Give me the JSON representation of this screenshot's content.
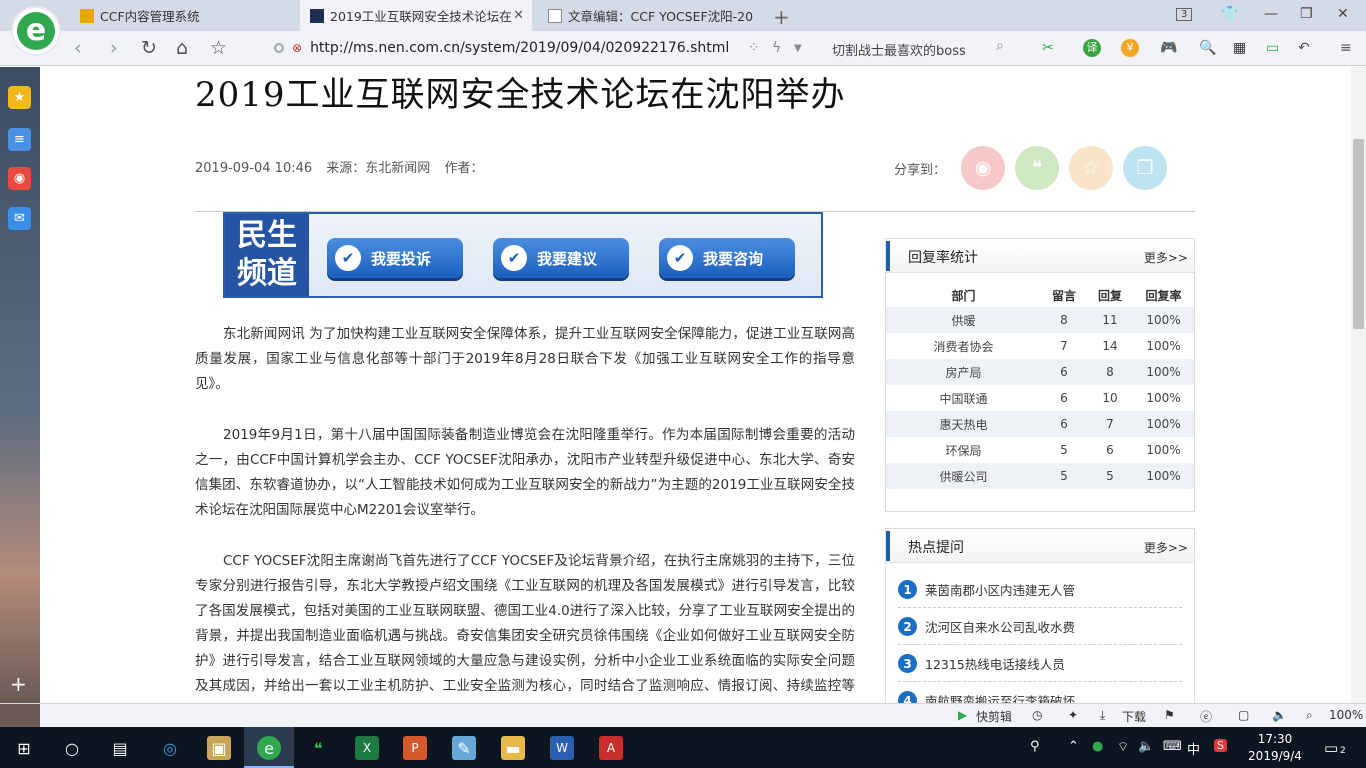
{
  "browser": {
    "tabs": [
      {
        "title": "CCF内容管理系统",
        "active": false
      },
      {
        "title": "2019工业互联网安全技术论坛在",
        "active": true
      },
      {
        "title": "文章编辑：CCF YOCSEF沈阳-20",
        "active": false
      }
    ],
    "tab_count": "3",
    "url": "http://ms.nen.com.cn/system/2019/09/04/020922176.shtml",
    "search_hint": "切割战士最喜欢的boss",
    "logo_letter": "e",
    "accent": "#2fa84f"
  },
  "article": {
    "title": "2019工业互联网安全技术论坛在沈阳举办",
    "date": "2019-09-04 10:46",
    "source": "来源：东北新闻网",
    "author": "作者：",
    "share_label": "分享到：",
    "share_icons": [
      "weibo-icon",
      "wechat-icon",
      "favorite-icon",
      "copy-icon"
    ],
    "banner": {
      "badge_line1": "民生",
      "badge_line2": "频道",
      "buttons": [
        "我要投诉",
        "我要建议",
        "我要咨询"
      ]
    },
    "paragraphs": [
      "东北新闻网讯 为了加快构建工业互联网安全保障体系，提升工业互联网安全保障能力，促进工业互联网高质量发展，国家工业与信息化部等十部门于2019年8月28日联合下发《加强工业互联网安全工作的指导意见》。",
      "2019年9月1日，第十八届中国国际装备制造业博览会在沈阳隆重举行。作为本届国际制博会重要的活动之一，由CCF中国计算机学会主办、CCF YOCSEF沈阳承办，沈阳市产业转型升级促进中心、东北大学、奇安信集团、东软睿道协办，以“人工智能技术如何成为工业互联网安全的新战力”为主题的2019工业互联网安全技术论坛在沈阳国际展览中心M2201会议室举行。",
      "CCF YOCSEF沈阳主席谢尚飞首先进行了CCF YOCSEF及论坛背景介绍，在执行主席姚羽的主持下，三位专家分别进行报告引导，东北大学教授卢绍文围绕《工业互联网的机理及各国发展模式》进行引导发言，比较了各国发展模式，包括对美国的工业互联网联盟、德国工业4.0进行了深入比较，分享了工业互联网安全提出的背景，并提出我国制造业面临机遇与挑战。奇安信集团安全研究员徐伟围绕《企业如何做好工业互联网安全防护》进行引导发言，结合工业互联网领域的大量应急与建设实例，分析中小企业工业系统面临的实际安全问题及其成因，并给出一套以工业主机防护、工业安全监测为核心，同时结合了监测响应、情报订阅、持续监控等一系列安全服务的企业工业安全整体解决方案，帮助企业有效提升工业安全能力。"
    ]
  },
  "reply_stats": {
    "title": "回复率统计",
    "more": "更多>>",
    "columns": [
      "部门",
      "留言",
      "回复",
      "回复率"
    ],
    "rows": [
      [
        "供暖",
        "8",
        "11",
        "100%"
      ],
      [
        "消费者协会",
        "7",
        "14",
        "100%"
      ],
      [
        "房产局",
        "6",
        "8",
        "100%"
      ],
      [
        "中国联通",
        "6",
        "10",
        "100%"
      ],
      [
        "惠天热电",
        "6",
        "7",
        "100%"
      ],
      [
        "环保局",
        "5",
        "6",
        "100%"
      ],
      [
        "供暖公司",
        "5",
        "5",
        "100%"
      ]
    ]
  },
  "hot_questions": {
    "title": "热点提问",
    "more": "更多>>",
    "items": [
      {
        "num": "1",
        "text": "莱茵南郡小区内违建无人管"
      },
      {
        "num": "2",
        "text": "沈河区自来水公司乱收水费"
      },
      {
        "num": "3",
        "text": "12315热线电话接线人员"
      },
      {
        "num": "4",
        "text": "南航野蛮搬运至行李箱破坏"
      }
    ]
  },
  "statusbar": {
    "quick_clip": "快剪辑",
    "download": "下载",
    "zoom": "100%"
  },
  "taskbar": {
    "time": "17:30",
    "date": "2019/9/4",
    "ime": "中",
    "notification_count": "2"
  }
}
